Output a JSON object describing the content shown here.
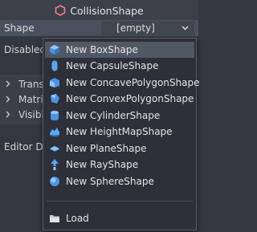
{
  "header": {
    "title": "CollisionShape",
    "icon": "collision-shape-icon"
  },
  "property": {
    "label": "Shape",
    "value": "[empty]"
  },
  "background_labels": {
    "disabled": "Disabled",
    "editor": "Editor Description"
  },
  "sections": [
    {
      "label": "Transform"
    },
    {
      "label": "Matrix"
    },
    {
      "label": "Visibility"
    }
  ],
  "menu": {
    "items": [
      {
        "label": "New BoxShape",
        "icon": "box-shape-icon"
      },
      {
        "label": "New CapsuleShape",
        "icon": "capsule-shape-icon"
      },
      {
        "label": "New ConcavePolygonShape",
        "icon": "concave-polygon-shape-icon"
      },
      {
        "label": "New ConvexPolygonShape",
        "icon": "convex-polygon-shape-icon"
      },
      {
        "label": "New CylinderShape",
        "icon": "cylinder-shape-icon"
      },
      {
        "label": "New HeightMapShape",
        "icon": "height-map-shape-icon"
      },
      {
        "label": "New PlaneShape",
        "icon": "plane-shape-icon"
      },
      {
        "label": "New RayShape",
        "icon": "ray-shape-icon"
      },
      {
        "label": "New SphereShape",
        "icon": "sphere-shape-icon"
      }
    ],
    "load_label": "Load",
    "load_icon": "folder-icon"
  },
  "colors": {
    "accent": "#56a8f0",
    "menu_bg": "#2d3038",
    "hover_bg": "#505866"
  }
}
